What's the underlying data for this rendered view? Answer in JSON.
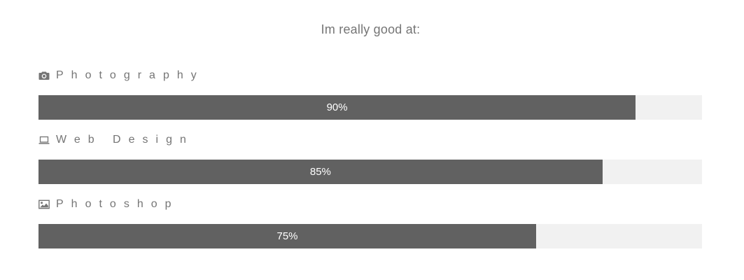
{
  "heading": "Im really good at:",
  "colors": {
    "bar_fill": "#616161",
    "bar_track": "#f1f1f1",
    "text": "#757575"
  },
  "skills": [
    {
      "icon": "camera-icon",
      "label": "Photography",
      "percent_text": "90%",
      "level": 90
    },
    {
      "icon": "laptop-icon",
      "label": "Web Design",
      "percent_text": "85%",
      "level": 85
    },
    {
      "icon": "image-icon",
      "label": "Photoshop",
      "percent_text": "75%",
      "level": 75
    }
  ]
}
